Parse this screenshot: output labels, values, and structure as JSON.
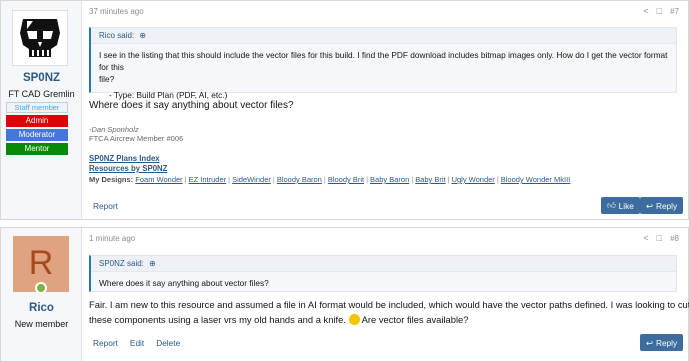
{
  "post1": {
    "username": "SP0NZ",
    "user_title": "FT CAD Gremlin",
    "staff_label": "Staff member",
    "banners": [
      "Admin",
      "Moderator",
      "Mentor"
    ],
    "time": "37 minutes ago",
    "post_number": "#7",
    "quote": {
      "author": "Rico said:",
      "line1": "I see in the listing that this should include the vector files for this build. I find the PDF download includes bitmap images only. How do I get the vector format for this",
      "line2": "file?",
      "line3": "- Type: Build Plan (PDF, AI, etc.)"
    },
    "body": "Where does it say anything about vector files?",
    "signature": {
      "name": "-Dan Sponholz",
      "member": "FTCA Aircrew Member #006",
      "link1": "SP0NZ Plans Index",
      "link2": "Resources by SP0NZ",
      "designs_label": "My Designs:",
      "designs": [
        "Foam Wonder",
        "EZ Intruder",
        "SideWinder",
        "Bloody Baron",
        "Bloody Brit",
        "Baby Baron",
        "Baby Brit",
        "Ugly Wonder",
        "Bloody Wonder MkIII"
      ]
    },
    "actions": [
      "Report"
    ],
    "like_label": "Like",
    "reply_label": "Reply"
  },
  "post2": {
    "avatar_letter": "R",
    "username": "Rico",
    "user_title": "New member",
    "time": "1 minute ago",
    "post_number": "#8",
    "quote": {
      "author": "SP0NZ said:",
      "line1": "Where does it say anything about vector files?"
    },
    "body_line1": "Fair. I am new to this resource and assumed a file in AI format would be included, which would have the vector paths defined. I was looking to cut",
    "body_line2a": "these components using a laser vrs my old hands and a knife.",
    "body_line2b": "Are vector files available?",
    "actions": [
      "Report",
      "Edit",
      "Delete"
    ],
    "reply_label": "Reply"
  },
  "colors": {
    "link": "#2c5988",
    "button": "#3d6d9e",
    "admin": "#e00000",
    "moderator": "#4477dd",
    "mentor": "#078a07",
    "rico_avatar_bg": "#dfa37f"
  },
  "icons": [
    "share-icon",
    "bookmark-icon",
    "expand-icon",
    "thumbs-up-icon",
    "reply-icon",
    "quote-toggle-icon"
  ]
}
